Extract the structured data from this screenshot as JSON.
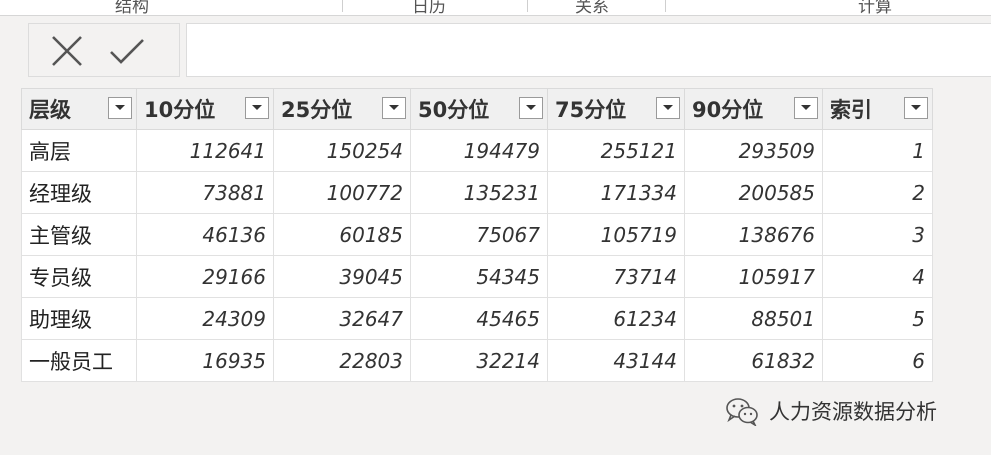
{
  "ribbon": {
    "groups": [
      "结构",
      "日历",
      "关系",
      "计算"
    ]
  },
  "formula_bar": {
    "cancel_icon": "close-icon",
    "confirm_icon": "check-icon",
    "value": ""
  },
  "table": {
    "columns": [
      "层级",
      "10分位",
      "25分位",
      "50分位",
      "75分位",
      "90分位",
      "索引"
    ],
    "rows": [
      [
        "高层",
        "112641",
        "150254",
        "194479",
        "255121",
        "293509",
        "1"
      ],
      [
        "经理级",
        "73881",
        "100772",
        "135231",
        "171334",
        "200585",
        "2"
      ],
      [
        "主管级",
        "46136",
        "60185",
        "75067",
        "105719",
        "138676",
        "3"
      ],
      [
        "专员级",
        "29166",
        "39045",
        "54345",
        "73714",
        "105917",
        "4"
      ],
      [
        "助理级",
        "24309",
        "32647",
        "45465",
        "61234",
        "88501",
        "5"
      ],
      [
        "一般员工",
        "16935",
        "22803",
        "32214",
        "43144",
        "61832",
        "6"
      ]
    ]
  },
  "watermark": {
    "icon": "wechat-icon",
    "text": "人力资源数据分析"
  }
}
